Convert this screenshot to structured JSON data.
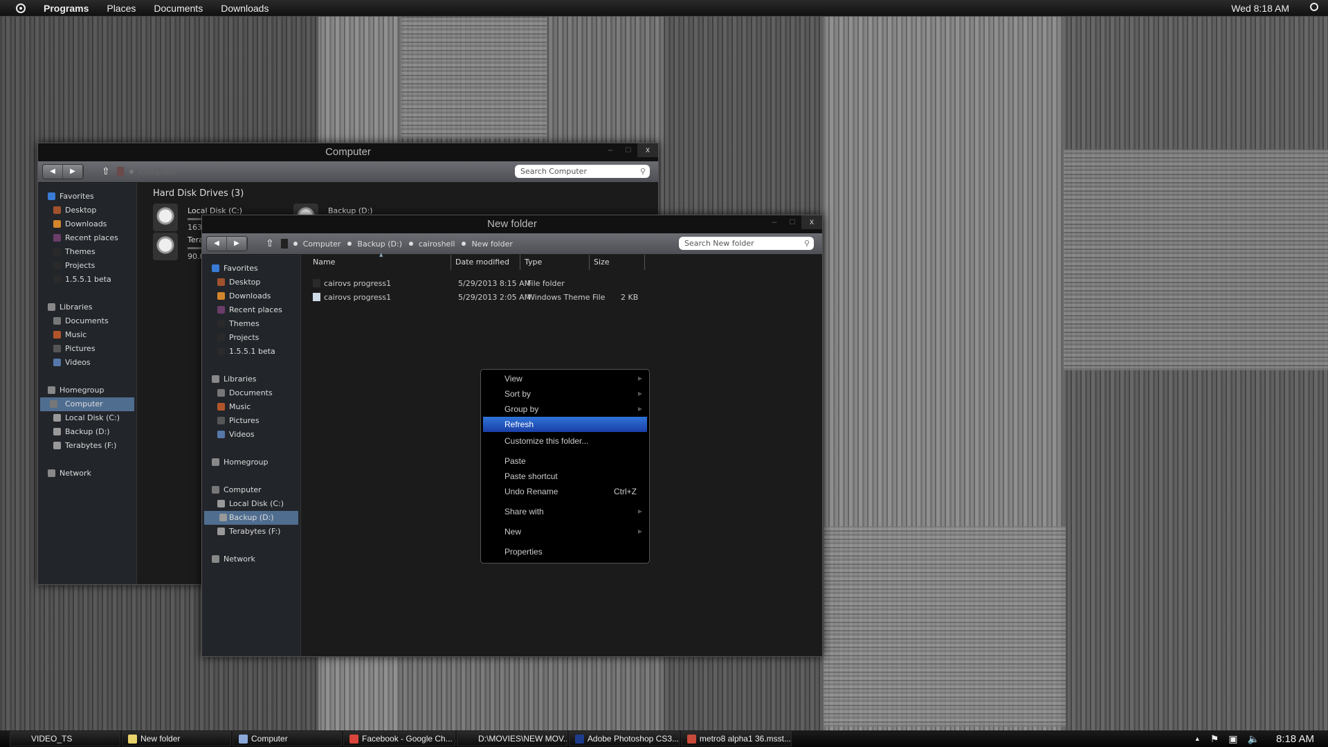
{
  "topbar": {
    "menus": [
      "Programs",
      "Places",
      "Documents",
      "Downloads"
    ],
    "clock": "Wed 8:18 AM"
  },
  "sidebar": [
    {
      "label": "Favorites",
      "top": true,
      "color": "#3a7bd5"
    },
    {
      "label": "Desktop",
      "color": "#a0522d"
    },
    {
      "label": "Downloads",
      "color": "#d2852a"
    },
    {
      "label": "Recent places",
      "color": "#6a3d6a"
    },
    {
      "label": "Themes",
      "color": "#2a2a2a"
    },
    {
      "label": "Projects",
      "color": "#2a2a2a"
    },
    {
      "label": "1.5.5.1 beta",
      "color": "#2a2a2a"
    },
    {
      "label": "Libraries",
      "top": true,
      "gap": true,
      "color": "#888"
    },
    {
      "label": "Documents",
      "color": "#777"
    },
    {
      "label": "Music",
      "color": "#b0552a"
    },
    {
      "label": "Pictures",
      "color": "#555"
    },
    {
      "label": "Videos",
      "color": "#5577aa"
    },
    {
      "label": "Homegroup",
      "top": true,
      "gap": true,
      "color": "#888"
    },
    {
      "label": "Computer",
      "top": true,
      "gap": true,
      "color": "#777"
    },
    {
      "label": "Local Disk (C:)",
      "color": "#999"
    },
    {
      "label": "Backup (D:)",
      "color": "#999"
    },
    {
      "label": "Terabytes (F:)",
      "color": "#999"
    },
    {
      "label": "Network",
      "top": true,
      "gap": true,
      "color": "#888"
    }
  ],
  "computer_window": {
    "title": "Computer",
    "crumb": "Computer",
    "search_placeholder": "Search Computer",
    "selected": "Computer",
    "group": "Hard Disk Drives (3)",
    "drives": [
      {
        "name": "Local Disk (C:)",
        "free": "163"
      },
      {
        "name": "Backup (D:)",
        "free": ""
      },
      {
        "name": "Tera",
        "free": "90.0"
      }
    ]
  },
  "folder_window": {
    "title": "New folder",
    "crumbs": [
      "Computer",
      "Backup (D:)",
      "cairoshell",
      "New folder"
    ],
    "search_placeholder": "Search New folder",
    "selected": "Backup (D:)",
    "columns": [
      "Name",
      "Date modified",
      "Type",
      "Size"
    ],
    "files": [
      {
        "name": "cairovs progress1",
        "date": "5/29/2013 8:15 AM",
        "type": "File folder",
        "size": ""
      },
      {
        "name": "cairovs progress1",
        "date": "5/29/2013 2:05 AM",
        "type": "Windows Theme File",
        "size": "2 KB"
      }
    ]
  },
  "context_menu": [
    {
      "label": "View",
      "submenu": true
    },
    {
      "label": "Sort by",
      "submenu": true
    },
    {
      "label": "Group by",
      "submenu": true
    },
    {
      "label": "Refresh",
      "highlighted": true
    },
    {
      "label": "Customize this folder..."
    },
    {
      "label": "Paste"
    },
    {
      "label": "Paste shortcut"
    },
    {
      "label": "Undo Rename",
      "shortcut": "Ctrl+Z"
    },
    {
      "label": "Share with",
      "submenu": true
    },
    {
      "label": "New",
      "submenu": true
    },
    {
      "label": "Properties"
    }
  ],
  "taskbar": {
    "tasks": [
      {
        "label": "VIDEO_TS",
        "icon": ""
      },
      {
        "label": "New folder",
        "icon": "#e8d26a"
      },
      {
        "label": "Computer",
        "icon": "#8aa8d8"
      },
      {
        "label": "Facebook - Google Ch...",
        "icon": "#d9453a"
      },
      {
        "label": "D:\\MOVIES\\NEW MOV...",
        "icon": ""
      },
      {
        "label": "Adobe Photoshop CS3...",
        "icon": "#1c3c8c"
      },
      {
        "label": "metro8 alpha1 36.msst...",
        "icon": "#c84a3a"
      }
    ],
    "clock": "8:18 AM"
  }
}
